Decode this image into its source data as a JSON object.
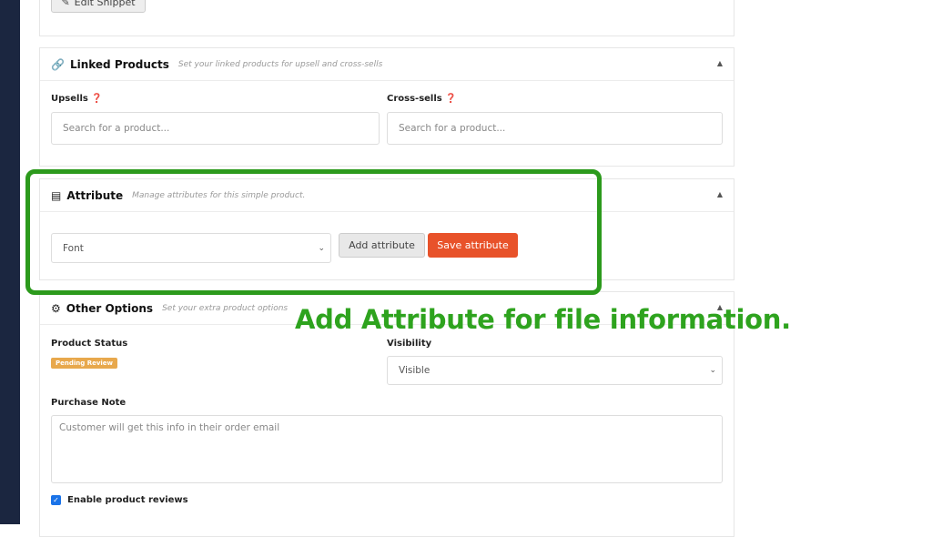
{
  "top_panel": {
    "edit_snippet_label": "Edit Snippet"
  },
  "linked_products": {
    "title": "Linked Products",
    "subtitle": "Set your linked products for upsell and cross-sells",
    "upsells_label": "Upsells",
    "cross_sells_label": "Cross-sells",
    "upsells_placeholder": "Search for a product...",
    "cross_sells_placeholder": "Search for a product..."
  },
  "attribute": {
    "title": "Attribute",
    "subtitle": "Manage attributes for this simple product.",
    "select_value": "Font",
    "add_label": "Add attribute",
    "save_label": "Save attribute"
  },
  "other_options": {
    "title": "Other Options",
    "subtitle": "Set your extra product options",
    "status_label": "Product Status",
    "status_badge": "Pending Review",
    "visibility_label": "Visibility",
    "visibility_value": "Visible",
    "purchase_note_label": "Purchase Note",
    "purchase_note_placeholder": "Customer will get this info in their order email",
    "reviews_label": "Enable product reviews",
    "reviews_checked": true
  },
  "annotation": "Add Attribute for file information.",
  "colors": {
    "sidebar": "#1b2640",
    "highlight": "#2c9a1c",
    "save_button": "#e8522a",
    "badge": "#e8a84c"
  }
}
